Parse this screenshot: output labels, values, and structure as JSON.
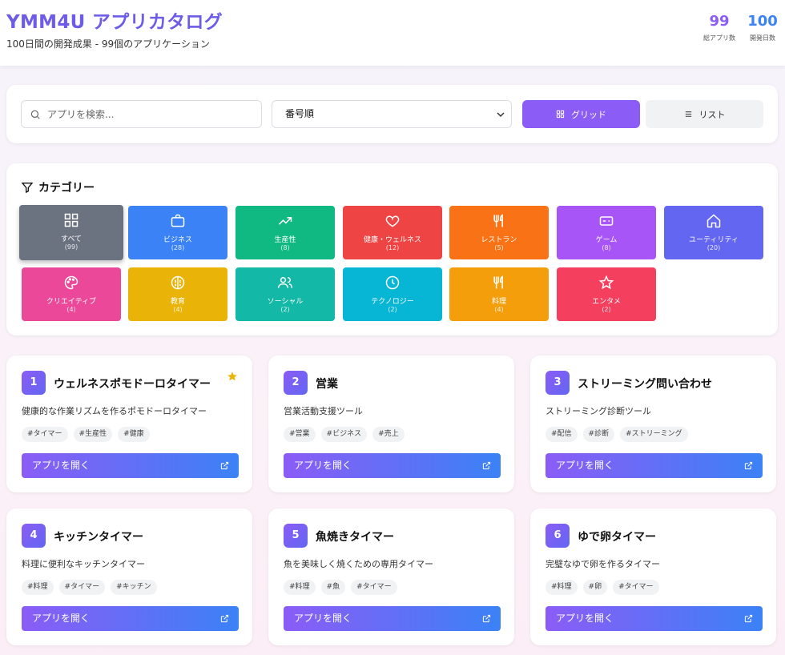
{
  "header": {
    "title": "YMM4U アプリカタログ",
    "subtitle": "100日間の開発成果 - 99個のアプリケーション",
    "stats": [
      {
        "value": "99",
        "label": "総アプリ数"
      },
      {
        "value": "100",
        "label": "開発日数"
      }
    ]
  },
  "controls": {
    "search_placeholder": "アプリを検索...",
    "sort_selected": "番号順",
    "grid_label": "グリッド",
    "list_label": "リスト"
  },
  "categories": {
    "heading": "カテゴリー",
    "items": [
      {
        "name": "すべて",
        "count": "(99)",
        "color": "#6b7280",
        "icon": "grid-icon"
      },
      {
        "name": "ビジネス",
        "count": "(28)",
        "color": "#3b82f6",
        "icon": "briefcase-icon"
      },
      {
        "name": "生産性",
        "count": "(8)",
        "color": "#10b981",
        "icon": "trending-up-icon"
      },
      {
        "name": "健康・ウェルネス",
        "count": "(12)",
        "color": "#ef4444",
        "icon": "heart-icon"
      },
      {
        "name": "レストラン",
        "count": "(5)",
        "color": "#f97316",
        "icon": "utensils-icon"
      },
      {
        "name": "ゲーム",
        "count": "(8)",
        "color": "#a855f7",
        "icon": "gamepad-icon"
      },
      {
        "name": "ユーティリティ",
        "count": "(20)",
        "color": "#6366f1",
        "icon": "home-icon"
      },
      {
        "name": "クリエイティブ",
        "count": "(4)",
        "color": "#ec4899",
        "icon": "palette-icon"
      },
      {
        "name": "教育",
        "count": "(4)",
        "color": "#eab308",
        "icon": "brain-icon"
      },
      {
        "name": "ソーシャル",
        "count": "(2)",
        "color": "#14b8a6",
        "icon": "users-icon"
      },
      {
        "name": "テクノロジー",
        "count": "(2)",
        "color": "#06b6d4",
        "icon": "clock-icon"
      },
      {
        "name": "料理",
        "count": "(4)",
        "color": "#f59e0b",
        "icon": "utensils-icon"
      },
      {
        "name": "エンタメ",
        "count": "(2)",
        "color": "#f43f5e",
        "icon": "star-icon"
      }
    ]
  },
  "apps": [
    {
      "number": "1",
      "title": "ウェルネスポモドーロタイマー",
      "description": "健康的な作業リズムを作るポモドーロタイマー",
      "tags": [
        "#タイマー",
        "#生産性",
        "#健康"
      ],
      "featured": true,
      "open_label": "アプリを開く"
    },
    {
      "number": "2",
      "title": "営業",
      "description": "営業活動支援ツール",
      "tags": [
        "#営業",
        "#ビジネス",
        "#売上"
      ],
      "featured": false,
      "open_label": "アプリを開く"
    },
    {
      "number": "3",
      "title": "ストリーミング問い合わせ",
      "description": "ストリーミング診断ツール",
      "tags": [
        "#配信",
        "#診断",
        "#ストリーミング"
      ],
      "featured": false,
      "open_label": "アプリを開く"
    },
    {
      "number": "4",
      "title": "キッチンタイマー",
      "description": "料理に便利なキッチンタイマー",
      "tags": [
        "#料理",
        "#タイマー",
        "#キッチン"
      ],
      "featured": false,
      "open_label": "アプリを開く"
    },
    {
      "number": "5",
      "title": "魚焼きタイマー",
      "description": "魚を美味しく焼くための専用タイマー",
      "tags": [
        "#料理",
        "#魚",
        "#タイマー"
      ],
      "featured": false,
      "open_label": "アプリを開く"
    },
    {
      "number": "6",
      "title": "ゆで卵タイマー",
      "description": "完璧なゆで卵を作るタイマー",
      "tags": [
        "#料理",
        "#卵",
        "#タイマー"
      ],
      "featured": false,
      "open_label": "アプリを開く"
    }
  ]
}
